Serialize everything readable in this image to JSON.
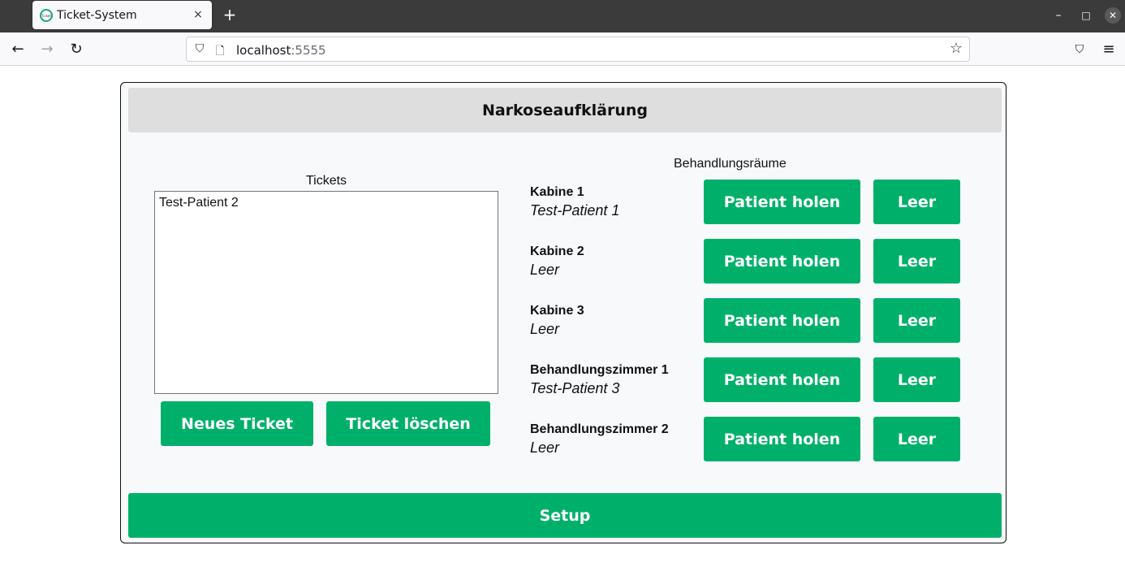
{
  "browser": {
    "tab_title": "Ticket-System",
    "tab_favicon_text": "Ticket",
    "url_host": "localhost",
    "url_port": ":5555",
    "icons": {
      "close": "×",
      "new_tab": "+",
      "minimize": "–",
      "maximize": "□",
      "window_close": "✕",
      "back": "←",
      "forward": "→",
      "reload": "↻",
      "shield": "⛉",
      "page": "🗋",
      "star": "☆",
      "pocket": "⛉",
      "menu": "≡"
    }
  },
  "page": {
    "header_title": "Narkoseaufklärung",
    "tickets_label": "Tickets",
    "tickets": [
      "Test-Patient 2"
    ],
    "new_ticket_label": "Neues Ticket",
    "delete_ticket_label": "Ticket löschen",
    "rooms_label": "Behandlungsräume",
    "rooms": [
      {
        "name": "Kabine 1",
        "patient": "Test-Patient 1",
        "fetch_label": "Patient holen",
        "empty_label": "Leer"
      },
      {
        "name": "Kabine 2",
        "patient": "Leer",
        "fetch_label": "Patient holen",
        "empty_label": "Leer"
      },
      {
        "name": "Kabine 3",
        "patient": "Leer",
        "fetch_label": "Patient holen",
        "empty_label": "Leer"
      },
      {
        "name": "Behandlungszimmer 1",
        "patient": "Test-Patient 3",
        "fetch_label": "Patient holen",
        "empty_label": "Leer"
      },
      {
        "name": "Behandlungszimmer 2",
        "patient": "Leer",
        "fetch_label": "Patient holen",
        "empty_label": "Leer"
      }
    ],
    "setup_label": "Setup"
  },
  "colors": {
    "accent_green": "#00b06a",
    "header_gray": "#dedede",
    "panel_bg": "#f8f9fa",
    "tabbar_bg": "#3b3b3b"
  }
}
